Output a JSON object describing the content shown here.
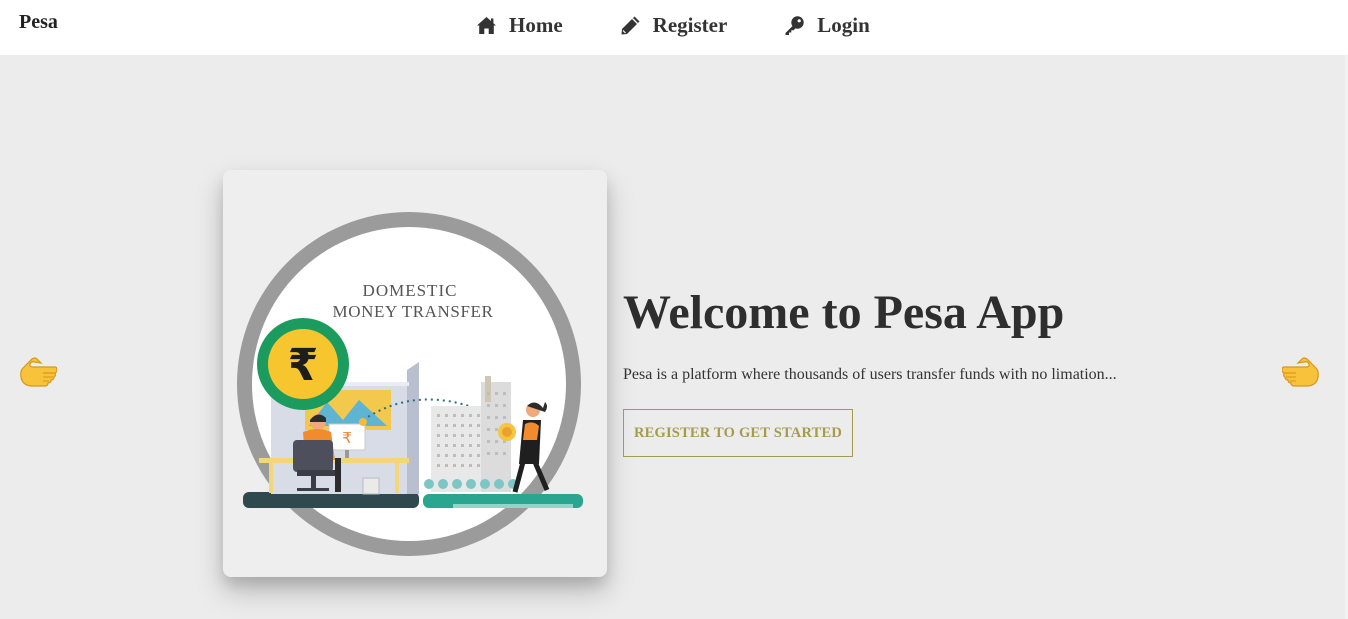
{
  "navbar": {
    "brand": "Pesa",
    "links": [
      {
        "label": "Home",
        "icon": "home-icon"
      },
      {
        "label": "Register",
        "icon": "pencil-icon"
      },
      {
        "label": "Login",
        "icon": "key-icon"
      }
    ]
  },
  "hero": {
    "image": {
      "line1": "DOMESTIC",
      "line2": "MONEY TRANSFER",
      "currency_symbol": "₹"
    },
    "title": "Welcome to Pesa App",
    "description": "Pesa is a platform where thousands of users transfer funds with no limation...",
    "cta_label": "REGISTER TO GET STARTED"
  },
  "carousel": {
    "prev_icon": "pointing-left-hand-icon",
    "next_icon": "pointing-right-hand-icon"
  },
  "colors": {
    "background": "#ececec",
    "navbar": "#ffffff",
    "accent": "#a39c4f",
    "title": "#2e2e2e"
  }
}
